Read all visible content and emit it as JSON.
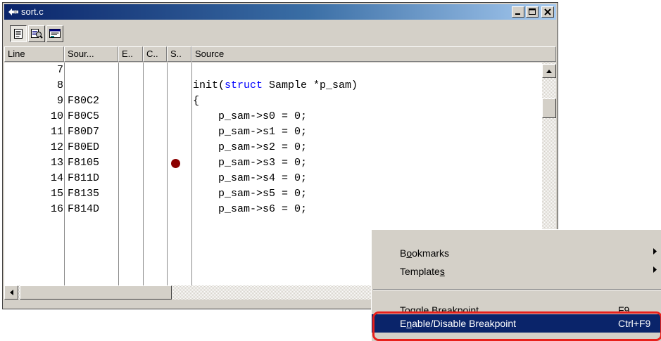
{
  "window": {
    "title": "sort.c",
    "buttons": [
      "minimize-icon",
      "maximize-icon",
      "close-icon"
    ]
  },
  "toolbar": {
    "buttons": [
      "source-view-icon",
      "mixed-view-icon",
      "disassembly-view-icon"
    ]
  },
  "columns": [
    "Line",
    "Sour...",
    "E..",
    "C..",
    "S..",
    "Source"
  ],
  "rows": [
    {
      "line": "7",
      "addr": "",
      "code": "",
      "bp": false
    },
    {
      "line": "8",
      "addr": "",
      "code_pre": "init(",
      "code_kw": "struct",
      "code_post": " Sample *p_sam)",
      "bp": false
    },
    {
      "line": "9",
      "addr": "F80C2",
      "code": "{",
      "bp": false
    },
    {
      "line": "10",
      "addr": "F80C5",
      "code": "    p_sam->s0 = 0;",
      "bp": false
    },
    {
      "line": "11",
      "addr": "F80D7",
      "code": "    p_sam->s1 = 0;",
      "bp": false
    },
    {
      "line": "12",
      "addr": "F80ED",
      "code": "    p_sam->s2 = 0;",
      "bp": false
    },
    {
      "line": "13",
      "addr": "F8105",
      "code": "    p_sam->s3 = 0;",
      "bp": true
    },
    {
      "line": "14",
      "addr": "F811D",
      "code": "    p_sam->s4 = 0;",
      "bp": false
    },
    {
      "line": "15",
      "addr": "F8135",
      "code": "    p_sam->s5 = 0;",
      "bp": false
    },
    {
      "line": "16",
      "addr": "F814D",
      "code": "    p_sam->s6 = 0;",
      "bp": false
    }
  ],
  "context_menu": {
    "bookmarks": {
      "pre": "B",
      "u": "o",
      "post": "okmarks"
    },
    "templates": {
      "pre": "Template",
      "u": "s",
      "post": ""
    },
    "toggle": {
      "pre": "Toggle Breakpoint",
      "u": "",
      "post": "",
      "shortcut": "F9"
    },
    "enable": {
      "pre": "E",
      "u": "n",
      "post": "able/Disable Breakpoint",
      "shortcut": "Ctrl+F9"
    }
  },
  "colors": {
    "highlight": "#0a246a",
    "breakpoint": "#8b0000",
    "keyword": "#0000ff",
    "annotation_ring": "#e8201b"
  }
}
